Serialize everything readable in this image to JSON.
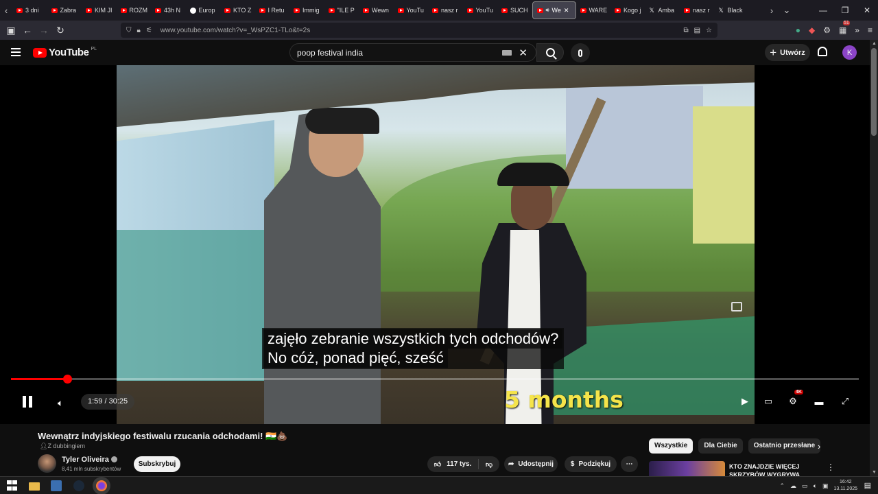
{
  "browser": {
    "tabs": [
      {
        "label": "3 dni",
        "icon": "youtube-icon"
      },
      {
        "label": "Zabra",
        "icon": "youtube-icon"
      },
      {
        "label": "KIM JI",
        "icon": "youtube-icon"
      },
      {
        "label": "ROZM",
        "icon": "youtube-icon"
      },
      {
        "label": "43h N",
        "icon": "youtube-icon"
      },
      {
        "label": "Europ",
        "icon": "web-icon"
      },
      {
        "label": "KTO Z",
        "icon": "youtube-icon"
      },
      {
        "label": "I Retu",
        "icon": "youtube-icon"
      },
      {
        "label": "Immig",
        "icon": "youtube-icon"
      },
      {
        "label": "\"ILE P",
        "icon": "youtube-icon"
      },
      {
        "label": "Wewn",
        "icon": "youtube-icon"
      },
      {
        "label": "YouTu",
        "icon": "youtube-icon"
      },
      {
        "label": "nasz r",
        "icon": "youtube-icon"
      },
      {
        "label": "YouTu",
        "icon": "youtube-icon"
      },
      {
        "label": "SUCH",
        "icon": "youtube-icon"
      },
      {
        "label": "We",
        "icon": "youtube-icon",
        "active": true
      },
      {
        "label": "WARE",
        "icon": "youtube-icon"
      },
      {
        "label": "Kogo j",
        "icon": "youtube-icon"
      },
      {
        "label": "Amba",
        "icon": "x-icon"
      },
      {
        "label": "nasz r",
        "icon": "youtube-icon"
      },
      {
        "label": "Black",
        "icon": "x-icon"
      }
    ],
    "url": "www.youtube.com/watch?v=_WsPZC1-TLo&t=2s",
    "notification_count": "51"
  },
  "youtube": {
    "logo_text": "YouTube",
    "country_code": "PL",
    "search_query": "poop festival india",
    "create_label": "Utwórz",
    "avatar_letter": "K"
  },
  "player": {
    "caption_line1": "zajęło zebranie wszystkich tych odchodów?",
    "caption_line2": "No cóż, ponad pięć, sześć",
    "burned_text": "5 months",
    "time_display": "1:59 / 30:25",
    "progress_fraction": 0.066,
    "quality_badge": "4K"
  },
  "video": {
    "title": "Wewnątrz indyjskiego festiwalu rzucania odchodami! 🇮🇳💩",
    "dub_label": "Z dubbingiem",
    "channel_name": "Tyler Oliveira",
    "subscribers": "8,41 mln subskrybentów",
    "subscribe_label": "Subskrybuj",
    "likes": "117 tys.",
    "share_label": "Udostępnij",
    "thanks_label": "Podziękuj"
  },
  "sidebar": {
    "chips": [
      "Wszystkie",
      "Dla Ciebie",
      "Ostatnio przesłane"
    ],
    "rec_title": "KTO ZNAJDZIE WIĘCEJ SKRZYBÓW WYGRYWA *AFERA*"
  },
  "taskbar": {
    "time": "16:42",
    "date": "13.11.2025"
  }
}
